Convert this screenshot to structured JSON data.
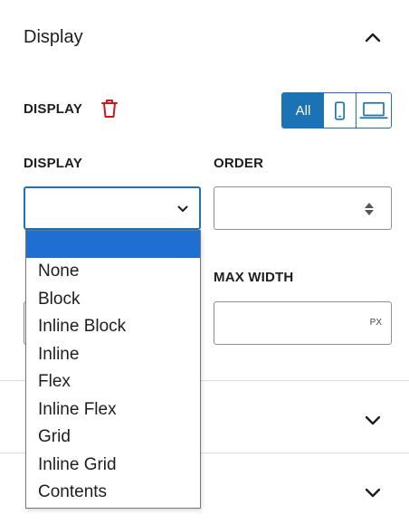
{
  "section": {
    "title": "Display"
  },
  "display_row": {
    "label": "DISPLAY"
  },
  "device_toggle": {
    "all_label": "All"
  },
  "fields": {
    "display_label": "DISPLAY",
    "order_label": "ORDER",
    "max_width_label": "MAX WIDTH",
    "max_width_unit": "PX",
    "order_value": "",
    "display_value": ""
  },
  "dropdown": {
    "options": [
      "",
      "None",
      "Block",
      "Inline Block",
      "Inline",
      "Flex",
      "Inline Flex",
      "Grid",
      "Inline Grid",
      "Contents"
    ],
    "selected_index": 0
  },
  "colors": {
    "accent": "#1b72b5",
    "danger": "#cc1818",
    "highlight": "#1e6fd1"
  }
}
